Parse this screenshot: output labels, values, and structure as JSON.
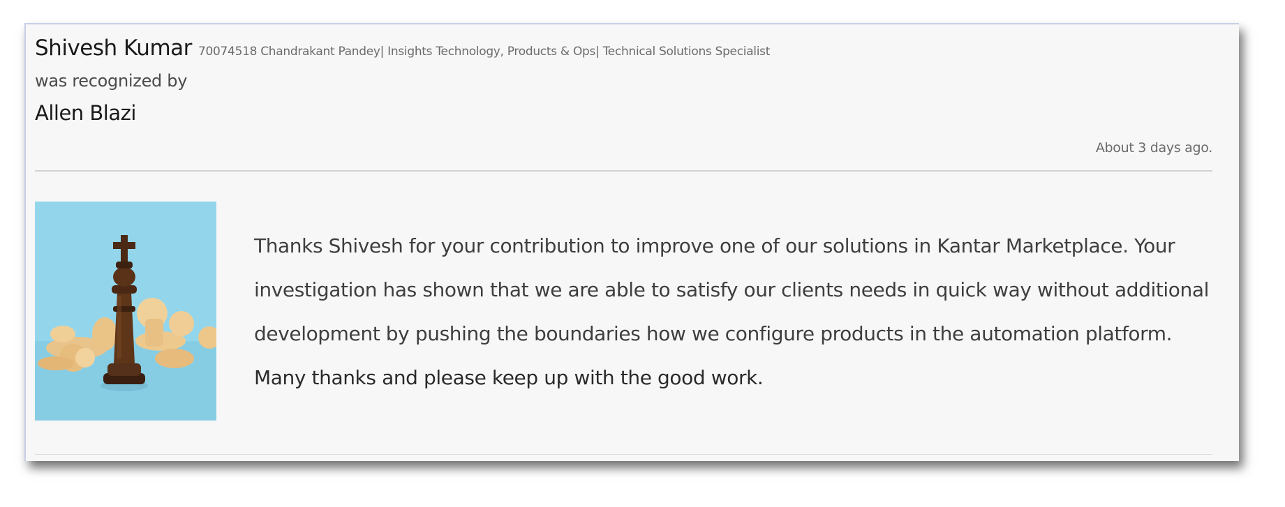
{
  "recognition": {
    "recipient_name": "Shivesh Kumar",
    "recipient_meta": "70074518 Chandrakant Pandey| Insights Technology, Products & Ops| Technical Solutions Specialist",
    "recognized_by_label": "was recognized by",
    "giver_name": "Allen Blazi",
    "timestamp": "About 3 days ago.",
    "image_icon": "chess-king-icon",
    "message_lines": [
      "Thanks Shivesh for your contribution to improve one of our solutions in Kantar Marketplace. Your",
      "investigation has shown that we are able to satisfy our clients needs in quick way without additional",
      "development by pushing the boundaries how we configure products in the automation platform.",
      "Many thanks and please keep up with the good work."
    ]
  }
}
